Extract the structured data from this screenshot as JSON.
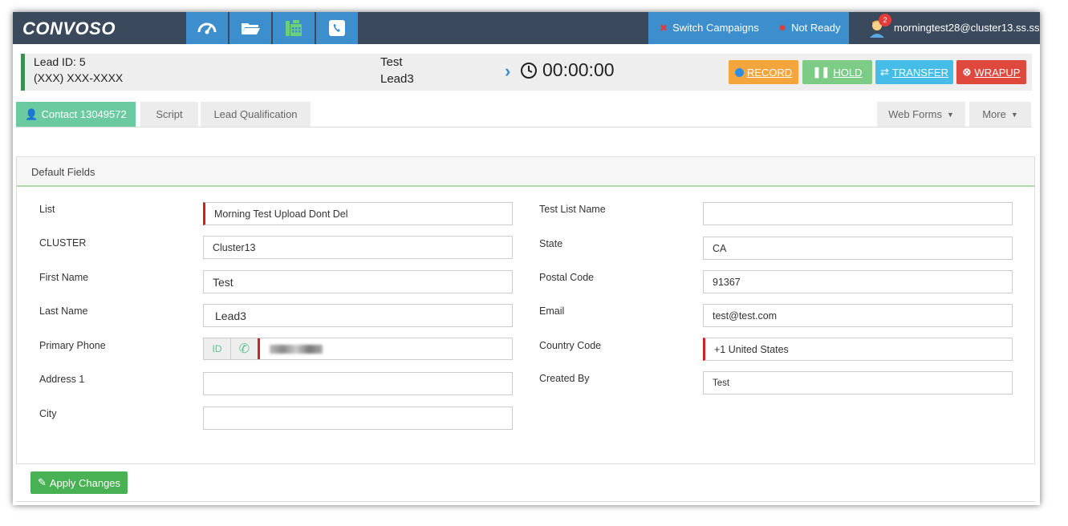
{
  "nav": {
    "logo": "CONVOSO",
    "icons": [
      "dashboard-icon",
      "folder-icon",
      "phone-keypad-icon",
      "phone-book-icon"
    ],
    "switch_campaigns": "Switch Campaigns",
    "not_ready": "Not Ready",
    "notification_count": "2",
    "user_email": "morningtest28@cluster13.ss.ss"
  },
  "call_bar": {
    "lead_id": "Lead ID: 5",
    "phone": "(XXX) XXX-XXXX",
    "name_first": "Test",
    "name_last": "Lead3",
    "timer": "00:00:00",
    "record_label": "RECORD",
    "hold_label": "HOLD",
    "transfer_label": "TRANSFER",
    "wrapup_label": "WRAPUP"
  },
  "tabs": {
    "contact": "Contact 13049572",
    "script": "Script",
    "lead_qualification": "Lead Qualification",
    "web_forms": "Web Forms",
    "more": "More"
  },
  "panel": {
    "title": "Default Fields",
    "left_fields": [
      {
        "label": "List",
        "value": "Morning Test Upload Dont Del"
      },
      {
        "label": "CLUSTER",
        "value": "Cluster13"
      },
      {
        "label": "First Name",
        "value": "Test"
      },
      {
        "label": "Last Name",
        "value": "Lead3"
      },
      {
        "label": "Primary Phone",
        "value": ""
      },
      {
        "label": "Address 1",
        "value": ""
      },
      {
        "label": "City",
        "value": ""
      }
    ],
    "right_fields": [
      {
        "label": "Test List Name",
        "value": ""
      },
      {
        "label": "State",
        "value": "CA"
      },
      {
        "label": "Postal Code",
        "value": "91367"
      },
      {
        "label": "Email",
        "value": "test@test.com"
      },
      {
        "label": "Country Code",
        "value": "+1 United States"
      },
      {
        "label": "Created By",
        "value": "Test"
      }
    ],
    "phone_id_button": "ID"
  },
  "apply_changes": "Apply Changes"
}
